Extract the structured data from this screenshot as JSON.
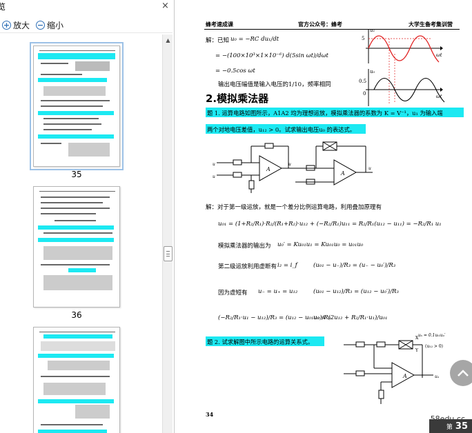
{
  "sidebar": {
    "title": "览",
    "close": "×",
    "zoom_in": {
      "icon": "zoom-in-icon",
      "symbol": "+",
      "label": "放大"
    },
    "zoom_out": {
      "icon": "zoom-out-icon",
      "symbol": "−",
      "label": "缩小"
    },
    "thumbnails": [
      {
        "page": "35",
        "selected": true
      },
      {
        "page": "36",
        "selected": false
      },
      {
        "page": "",
        "selected": false
      }
    ]
  },
  "page": {
    "header_left": "蜂考速成课",
    "header_mid": "官方公众号：蜂考",
    "header_right": "大学生备考集训营",
    "sol1": {
      "prefix": "解：已知",
      "eq1": "u₀ = −RC du₁/dt",
      "eq2": "= −(100×10³×1×10⁻⁶) d(5sin ωt)/dωt",
      "eq3": "= −0.5cos ωt",
      "note": "输出电压幅值是输入电压的1/10，频率相同"
    },
    "section_title": "2.模拟乘法器",
    "q1": {
      "line1": "题 1. 运算电路如图所示，A1A2 均为理想运放，模拟乘法器的系数为 K = V⁻¹，u₁ 为输入端",
      "line2": "两个对地电压差值，u₁₂ > 0。试求输出电压u₀ 的表达式。"
    },
    "sol2": {
      "intro": "解：对于第一级运放，就是一个差分比例运算电路，利用叠加原理有",
      "eq1": "u₀₁ = (1+R₂/R₁)·R₂/(R₁+R₂)·u₁₂ + (−R₂/R₁)u₁₁ = R₂/R₁(u₁₂ − u₁₁) = −R₂/R₁ u₁",
      "eq2_label": "模拟乘法器的输出为",
      "eq2": "u₀′ = Ku₀₁u₁ = Ku₀₁u₀ = u₀₁u₀",
      "eq3_label": "第二级运放利用虚断有",
      "eq3a": "i₂ = i_f",
      "eq3b": "(u₀₁ − u₋)/R₃ = (u₋ − u₀′)/R₃",
      "eq4_label": "因为虚短有",
      "eq4a": "u₋ = u₊ = u₁₂",
      "eq4b": "(u₀₁ − u₁₂)/R₃ = (u₁₂ − u₀′)/R₃",
      "eq5a": "(−R₂/R₁·u₁ − u₁₂)/R₃ = (u₁₂ − u₀₁u₀)/R₃",
      "eq5b": "u₀ = (2u₁₂ + R₂/R₁·u₁)/u₀₁"
    },
    "q2": "题 2. 试求解图中所示电路的运算关系式。",
    "q2_circuit": {
      "ux": "uₓ = 0.1uᵢ₁uₒ′",
      "cond": "(u₁₂ > 0)",
      "y": "Y",
      "x": "X",
      "uo": "uₒ"
    },
    "page_number": "34",
    "watermark": "58edu.cc",
    "badge_page": "35",
    "badge_prefix": "第"
  },
  "graph": {
    "ylabel_top": "u₁",
    "ylabel_bottom": "u₀",
    "val_top": "5",
    "val_bottom": "0.5",
    "xlabel": "ωt",
    "zero": "0"
  }
}
